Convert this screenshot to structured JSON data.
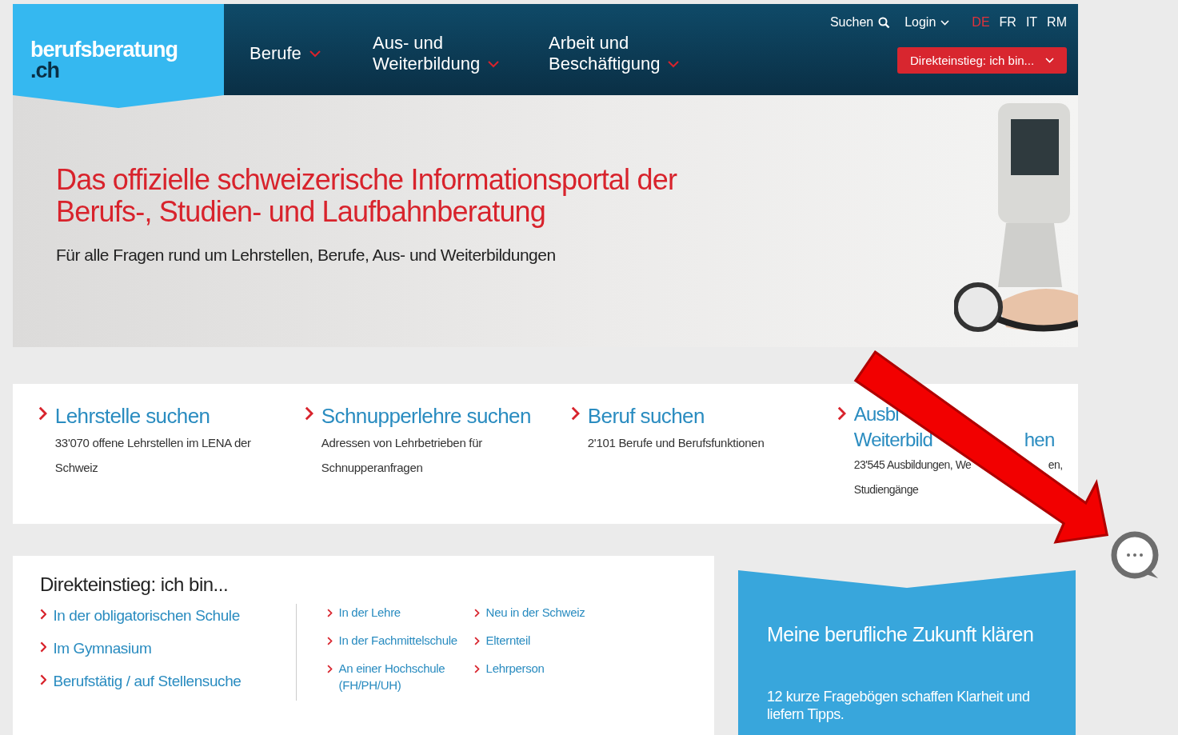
{
  "logo": {
    "line1": "berufsberatung",
    "line2": ".ch"
  },
  "nav": [
    {
      "lines": [
        "Berufe"
      ]
    },
    {
      "lines": [
        "Aus- und",
        "Weiterbildung"
      ]
    },
    {
      "lines": [
        "Arbeit und",
        "Beschäftigung"
      ]
    }
  ],
  "utility": {
    "search": "Suchen",
    "login": "Login"
  },
  "languages": [
    {
      "label": "DE",
      "selected": true
    },
    {
      "label": "FR",
      "selected": false
    },
    {
      "label": "IT",
      "selected": false
    },
    {
      "label": "RM",
      "selected": false
    }
  ],
  "direct_button": "Direkteinstieg: ich bin...",
  "hero": {
    "title_lines": [
      "Das offizielle schweizerische Informationsportal der",
      "Berufs-, Studien- und Laufbahnberatung"
    ],
    "subtitle": "Für alle Fragen rund um Lehrstellen, Berufe, Aus- und Weiterbildungen"
  },
  "cards": [
    {
      "kind": "full",
      "title": "Lehrstelle suchen",
      "description": "33'070 offene Lehrstellen im LENA der Schweiz"
    },
    {
      "kind": "full",
      "title": "Schnupperlehre suchen",
      "description": "Adressen von Lehrbetrieben für Schnupperanfragen"
    },
    {
      "kind": "full",
      "title": "Beruf suchen",
      "description": "2'101 Berufe und Berufsfunktionen"
    },
    {
      "kind": "partial",
      "title_lines": [
        [
          "Ausbi"
        ],
        [
          "Weiterbild",
          "hen"
        ]
      ],
      "description_lines": [
        [
          "23'545 Ausbildungen, We",
          "en,"
        ],
        [
          "Studiengänge"
        ]
      ]
    }
  ],
  "direct_entry": {
    "title": "Direkteinstieg: ich bin...",
    "main_links": [
      "In der obligatorischen Schule",
      "Im Gymnasium",
      "Berufstätig / auf Stellensuche"
    ],
    "columns": [
      [
        "In der Lehre",
        "In der Fachmittelschule",
        "An einer Hochschule (FH/PH/UH)"
      ],
      [
        "Neu in der Schweiz",
        "Elternteil",
        "Lehrperson"
      ]
    ]
  },
  "promo": {
    "title": "Meine berufliche Zukunft klären",
    "text": "12 kurze Fragebögen schaffen Klarheit und liefern Tipps."
  }
}
